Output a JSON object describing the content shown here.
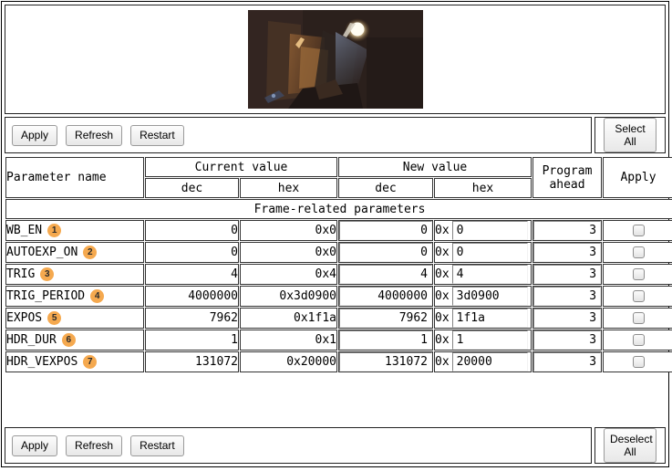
{
  "preview": {
    "label": "camera-video-frame",
    "description": "Dark night scene with bright street lamp"
  },
  "toolbar_top": {
    "apply_label": "Apply",
    "refresh_label": "Refresh",
    "restart_label": "Restart",
    "select_all_label": "Select\nAll",
    "select_all_line1": "Select",
    "select_all_line2": "All"
  },
  "toolbar_bottom": {
    "apply_label": "Apply",
    "refresh_label": "Refresh",
    "restart_label": "Restart",
    "deselect_all_line1": "Deselect",
    "deselect_all_line2": "All"
  },
  "table": {
    "header": {
      "parameter_name": "Parameter name",
      "current_value": "Current value",
      "new_value": "New value",
      "program_ahead_line1": "Program",
      "program_ahead_line2": "ahead",
      "apply": "Apply",
      "dec": "dec",
      "hex": "hex"
    },
    "section_title": "Frame-related parameters",
    "hex_prefix": "0x",
    "rows": [
      {
        "index": "1",
        "name": "WB_EN",
        "current_dec": "0",
        "current_hex": "0x0",
        "new_dec": "0",
        "new_hex": "0",
        "program_ahead": "3",
        "apply_checked": false
      },
      {
        "index": "2",
        "name": "AUTOEXP_ON",
        "current_dec": "0",
        "current_hex": "0x0",
        "new_dec": "0",
        "new_hex": "0",
        "program_ahead": "3",
        "apply_checked": false
      },
      {
        "index": "3",
        "name": "TRIG",
        "current_dec": "4",
        "current_hex": "0x4",
        "new_dec": "4",
        "new_hex": "4",
        "program_ahead": "3",
        "apply_checked": false
      },
      {
        "index": "4",
        "name": "TRIG_PERIOD",
        "current_dec": "4000000",
        "current_hex": "0x3d0900",
        "new_dec": "4000000",
        "new_hex": "3d0900",
        "program_ahead": "3",
        "apply_checked": false
      },
      {
        "index": "5",
        "name": "EXPOS",
        "current_dec": "7962",
        "current_hex": "0x1f1a",
        "new_dec": "7962",
        "new_hex": "1f1a",
        "program_ahead": "3",
        "apply_checked": false
      },
      {
        "index": "6",
        "name": "HDR_DUR",
        "current_dec": "1",
        "current_hex": "0x1",
        "new_dec": "1",
        "new_hex": "1",
        "program_ahead": "3",
        "apply_checked": false
      },
      {
        "index": "7",
        "name": "HDR_VEXPOS",
        "current_dec": "131072",
        "current_hex": "0x20000",
        "new_dec": "131072",
        "new_hex": "20000",
        "program_ahead": "3",
        "apply_checked": false
      }
    ]
  },
  "colors": {
    "badge_bg": "#f5a94f",
    "badge_text": "#2b2b2b",
    "border": "#333333",
    "button_face": "#e8e8e8"
  }
}
